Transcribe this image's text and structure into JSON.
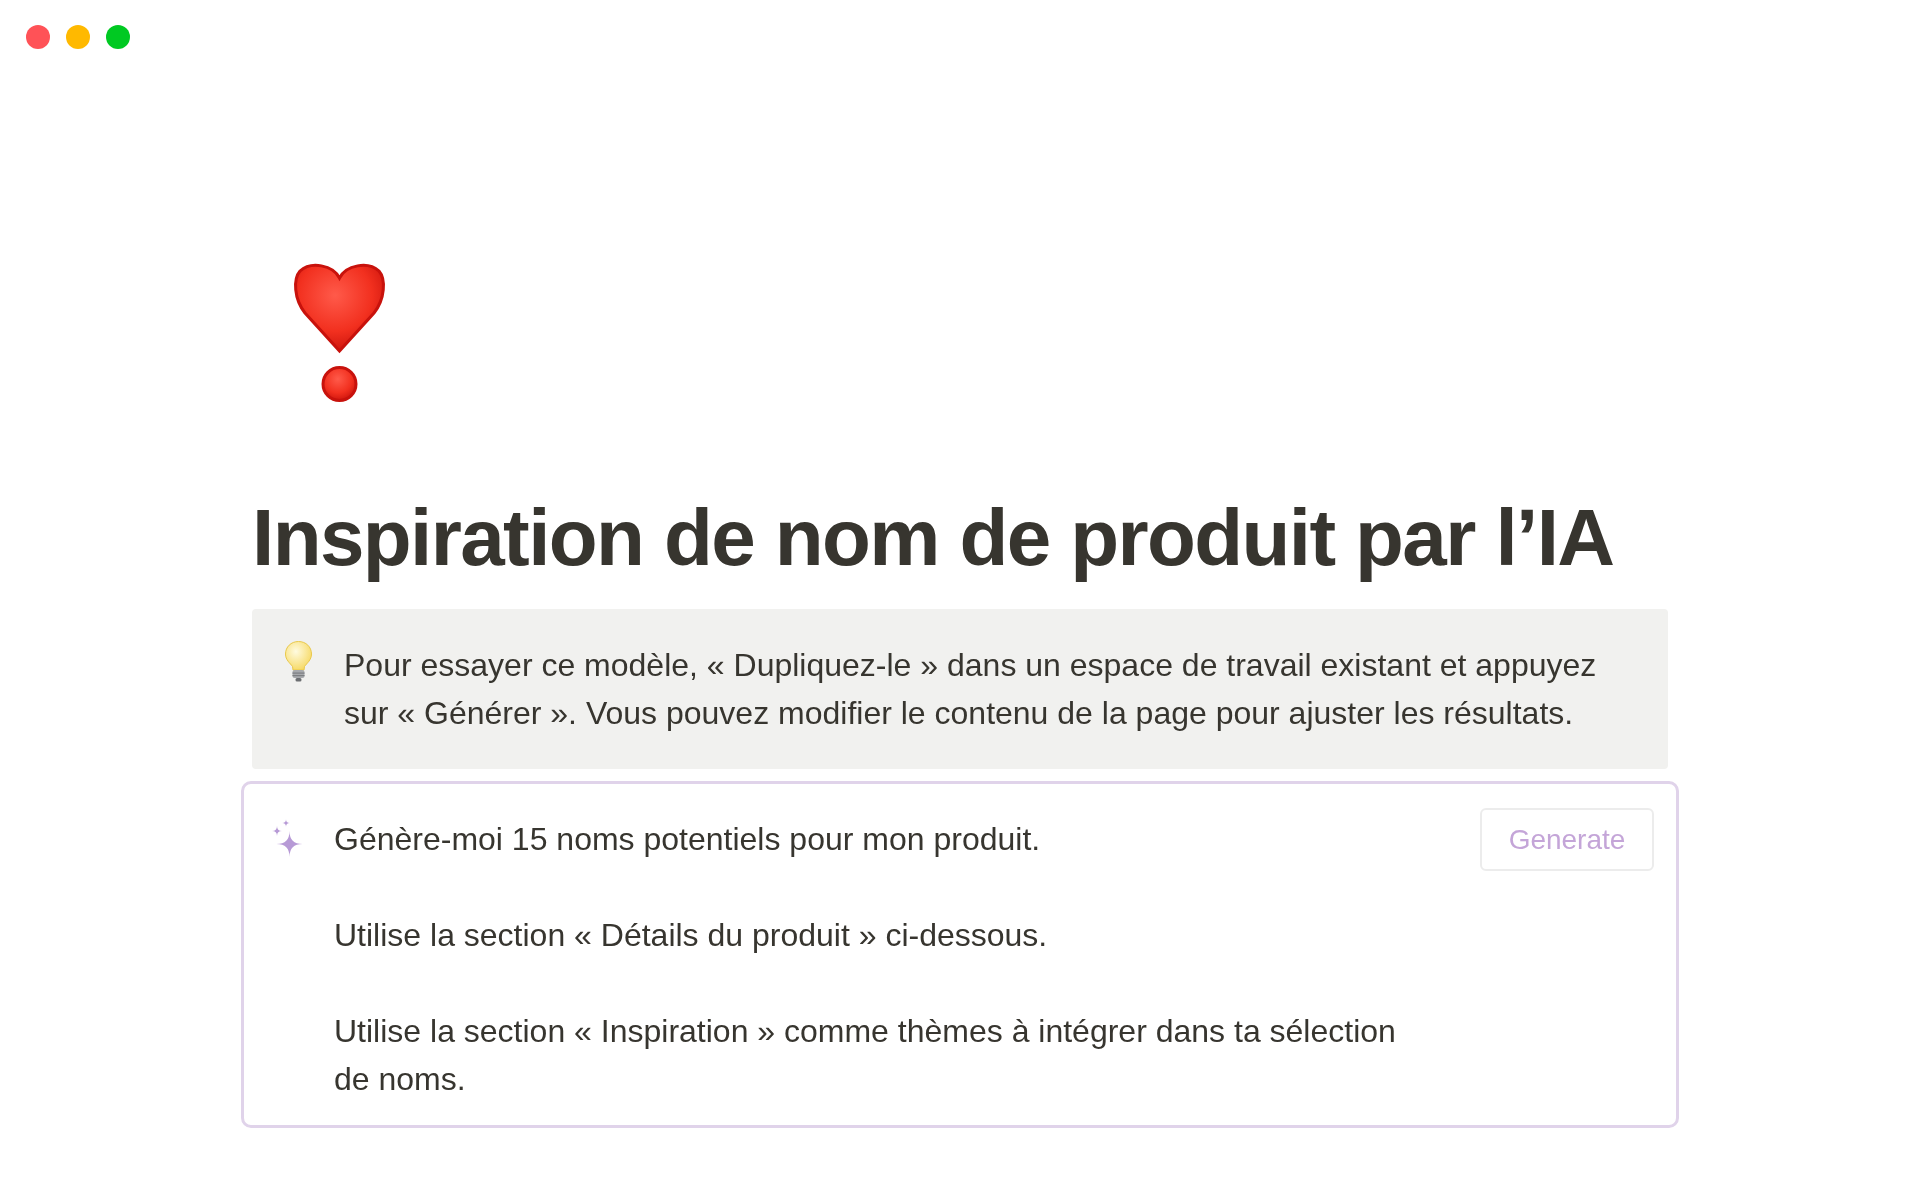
{
  "window_controls": [
    {
      "color": "#ff5257"
    },
    {
      "color": "#ffb900"
    },
    {
      "color": "#00c922"
    }
  ],
  "page": {
    "title": "Inspiration de nom de produit par l’IA",
    "callout": {
      "text": "Pour essayer ce modèle, « Dupliquez-le » dans un espace de travail existant et appuyez sur « Générer ». Vous pouvez modifier le contenu de la page pour ajuster les résultats."
    },
    "ai_block": {
      "paragraphs": [
        "Génère-moi 15 noms potentiels pour mon produit.",
        "Utilise la section « Détails du produit » ci-dessous.",
        "Utilise la section « Inspiration » comme thèmes à intégrer dans ta sélection de noms."
      ],
      "button": {
        "label": "Generate"
      }
    }
  }
}
